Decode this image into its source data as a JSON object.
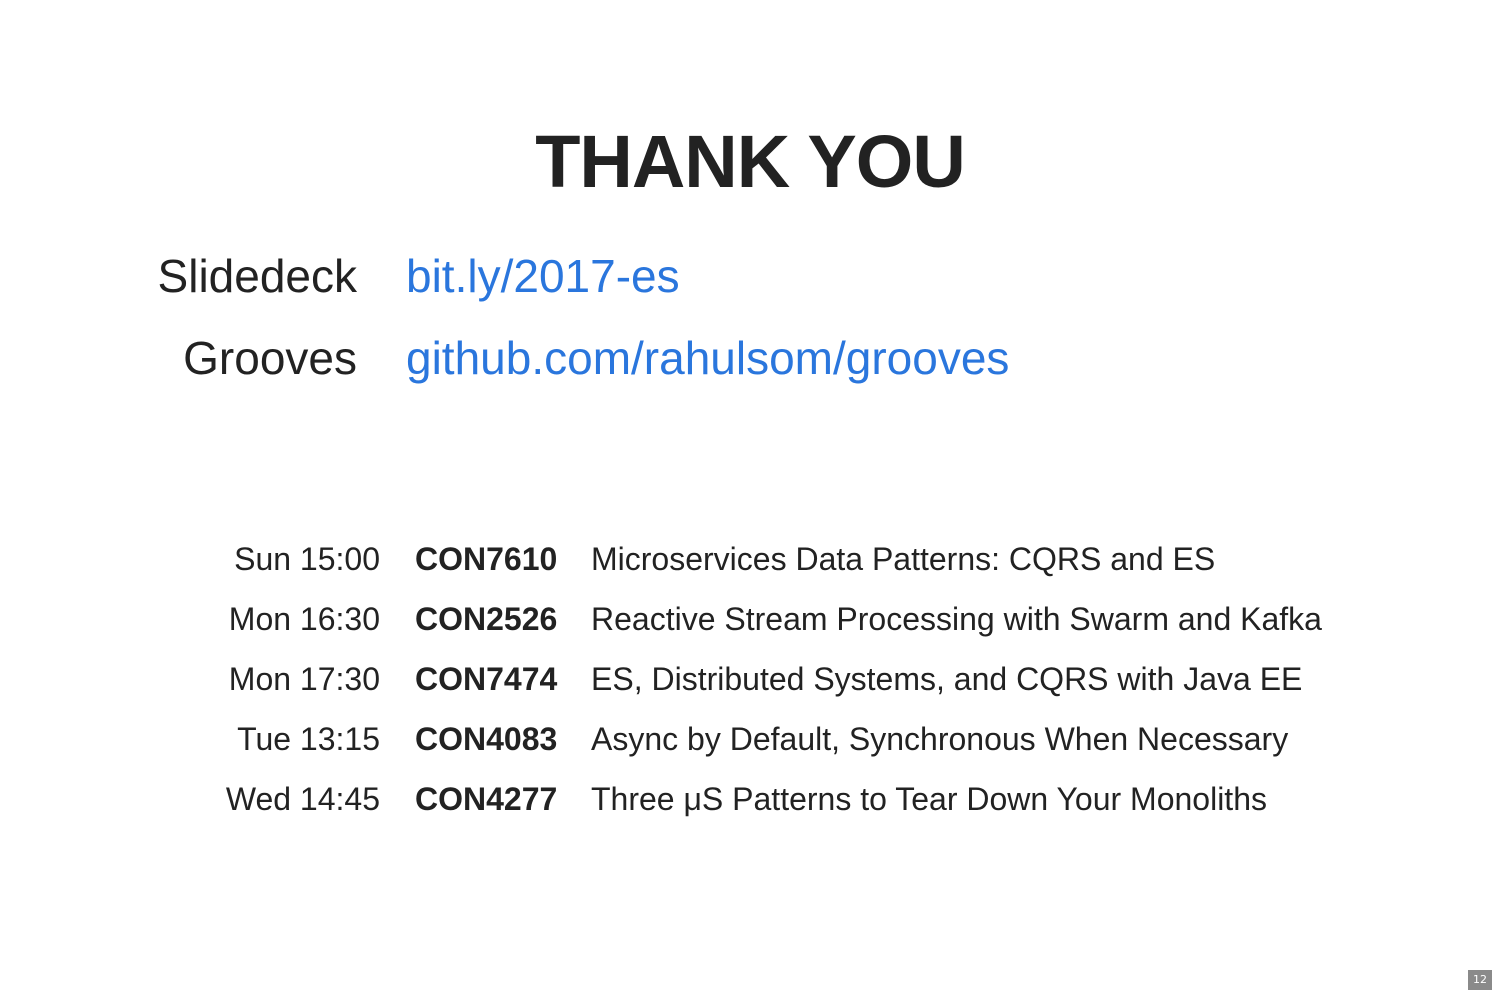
{
  "slide": {
    "title": "THANK YOU",
    "links": [
      {
        "label": "Slidedeck",
        "url_text": "bit.ly/2017-es"
      },
      {
        "label": "Grooves",
        "url_text": "github.com/rahulsom/grooves"
      }
    ],
    "sessions": [
      {
        "time": "Sun 15:00",
        "code": "CON7610",
        "title": "Microservices Data Patterns: CQRS and ES"
      },
      {
        "time": "Mon 16:30",
        "code": "CON2526",
        "title": "Reactive Stream Processing with Swarm and Kafka"
      },
      {
        "time": "Mon 17:30",
        "code": "CON7474",
        "title": "ES, Distributed Systems, and CQRS with Java EE"
      },
      {
        "time": "Tue 13:15",
        "code": "CON4083",
        "title": "Async by Default, Synchronous When Necessary"
      },
      {
        "time": "Wed 14:45",
        "code": "CON4277",
        "title": "Three μS Patterns to Tear Down Your Monoliths"
      }
    ],
    "page_number": "12"
  },
  "colors": {
    "text": "#222222",
    "link": "#2a76dd",
    "background": "#ffffff",
    "page_badge": "#8a8a8a"
  }
}
